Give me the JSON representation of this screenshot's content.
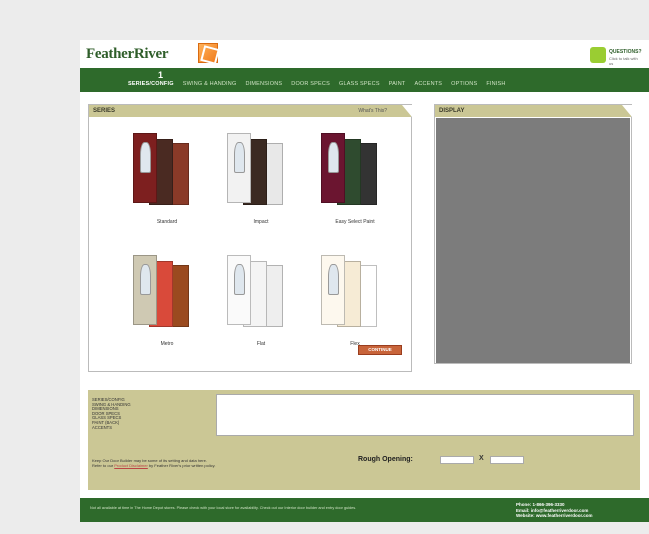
{
  "header": {
    "logo_text": "FeatherRiver",
    "questions_title": "QUESTIONS?",
    "questions_sub": "Click to talk with us"
  },
  "nav": {
    "step_number": "1",
    "items": [
      {
        "label": "SERIES/CONFIG",
        "active": true
      },
      {
        "label": "SWING & HANDING"
      },
      {
        "label": "DIMENSIONS"
      },
      {
        "label": "DOOR SPECS"
      },
      {
        "label": "GLASS SPECS"
      },
      {
        "label": "PAINT"
      },
      {
        "label": "ACCENTS"
      },
      {
        "label": "OPTIONS"
      },
      {
        "label": "FINISH"
      }
    ]
  },
  "series": {
    "title": "SERIES",
    "whats_this": "What's This?",
    "cards": [
      {
        "label": "Standard",
        "colors": [
          "#7d1f1f",
          "#4a2a22",
          "#8a3a28"
        ]
      },
      {
        "label": "Impact",
        "colors": [
          "#f2f2f2",
          "#3b2a22",
          "#e8e8e8"
        ]
      },
      {
        "label": "Easy Select Paint",
        "colors": [
          "#6b1530",
          "#2f4b2f",
          "#333"
        ]
      },
      {
        "label": "Metro",
        "colors": [
          "#cfc9b3",
          "#d94a3a",
          "#9a4a1f"
        ]
      },
      {
        "label": "Flat",
        "colors": [
          "#fafafa",
          "#f4f4f4",
          "#eeeeee"
        ]
      },
      {
        "label": "Flex",
        "colors": [
          "#fdf8ee",
          "#f6ebd5",
          "#ffffff"
        ]
      }
    ],
    "continue_label": "CONTINUE"
  },
  "display": {
    "title": "DISPLAY"
  },
  "summary": {
    "items": [
      "SERIES/CONFIG",
      "SWING & HANDING",
      "DIMENSIONS",
      "DOOR SPECS",
      "GLASS SPECS",
      "PAINT (BACK)",
      "ACCENTS"
    ],
    "note_line1": "Keep Our Door Builder may be some of its setting and data here.",
    "note_line2_prefix": "Refer to our",
    "note_link": "Product Disclaimer",
    "note_line2_suffix": "by Feather River's prior written policy.",
    "rough_opening_label": "Rough Opening:",
    "rough_x": "X"
  },
  "footer": {
    "text": "Not all available at time in The Home Depot stores. Please check with your local store for availability. Check out our Interior door builder and entry door guides.",
    "phone": "Phone: 1-866-396-3330",
    "email": "Email: info@featherriverdoor.com",
    "website": "Website: www.featherriverdoor.com"
  }
}
